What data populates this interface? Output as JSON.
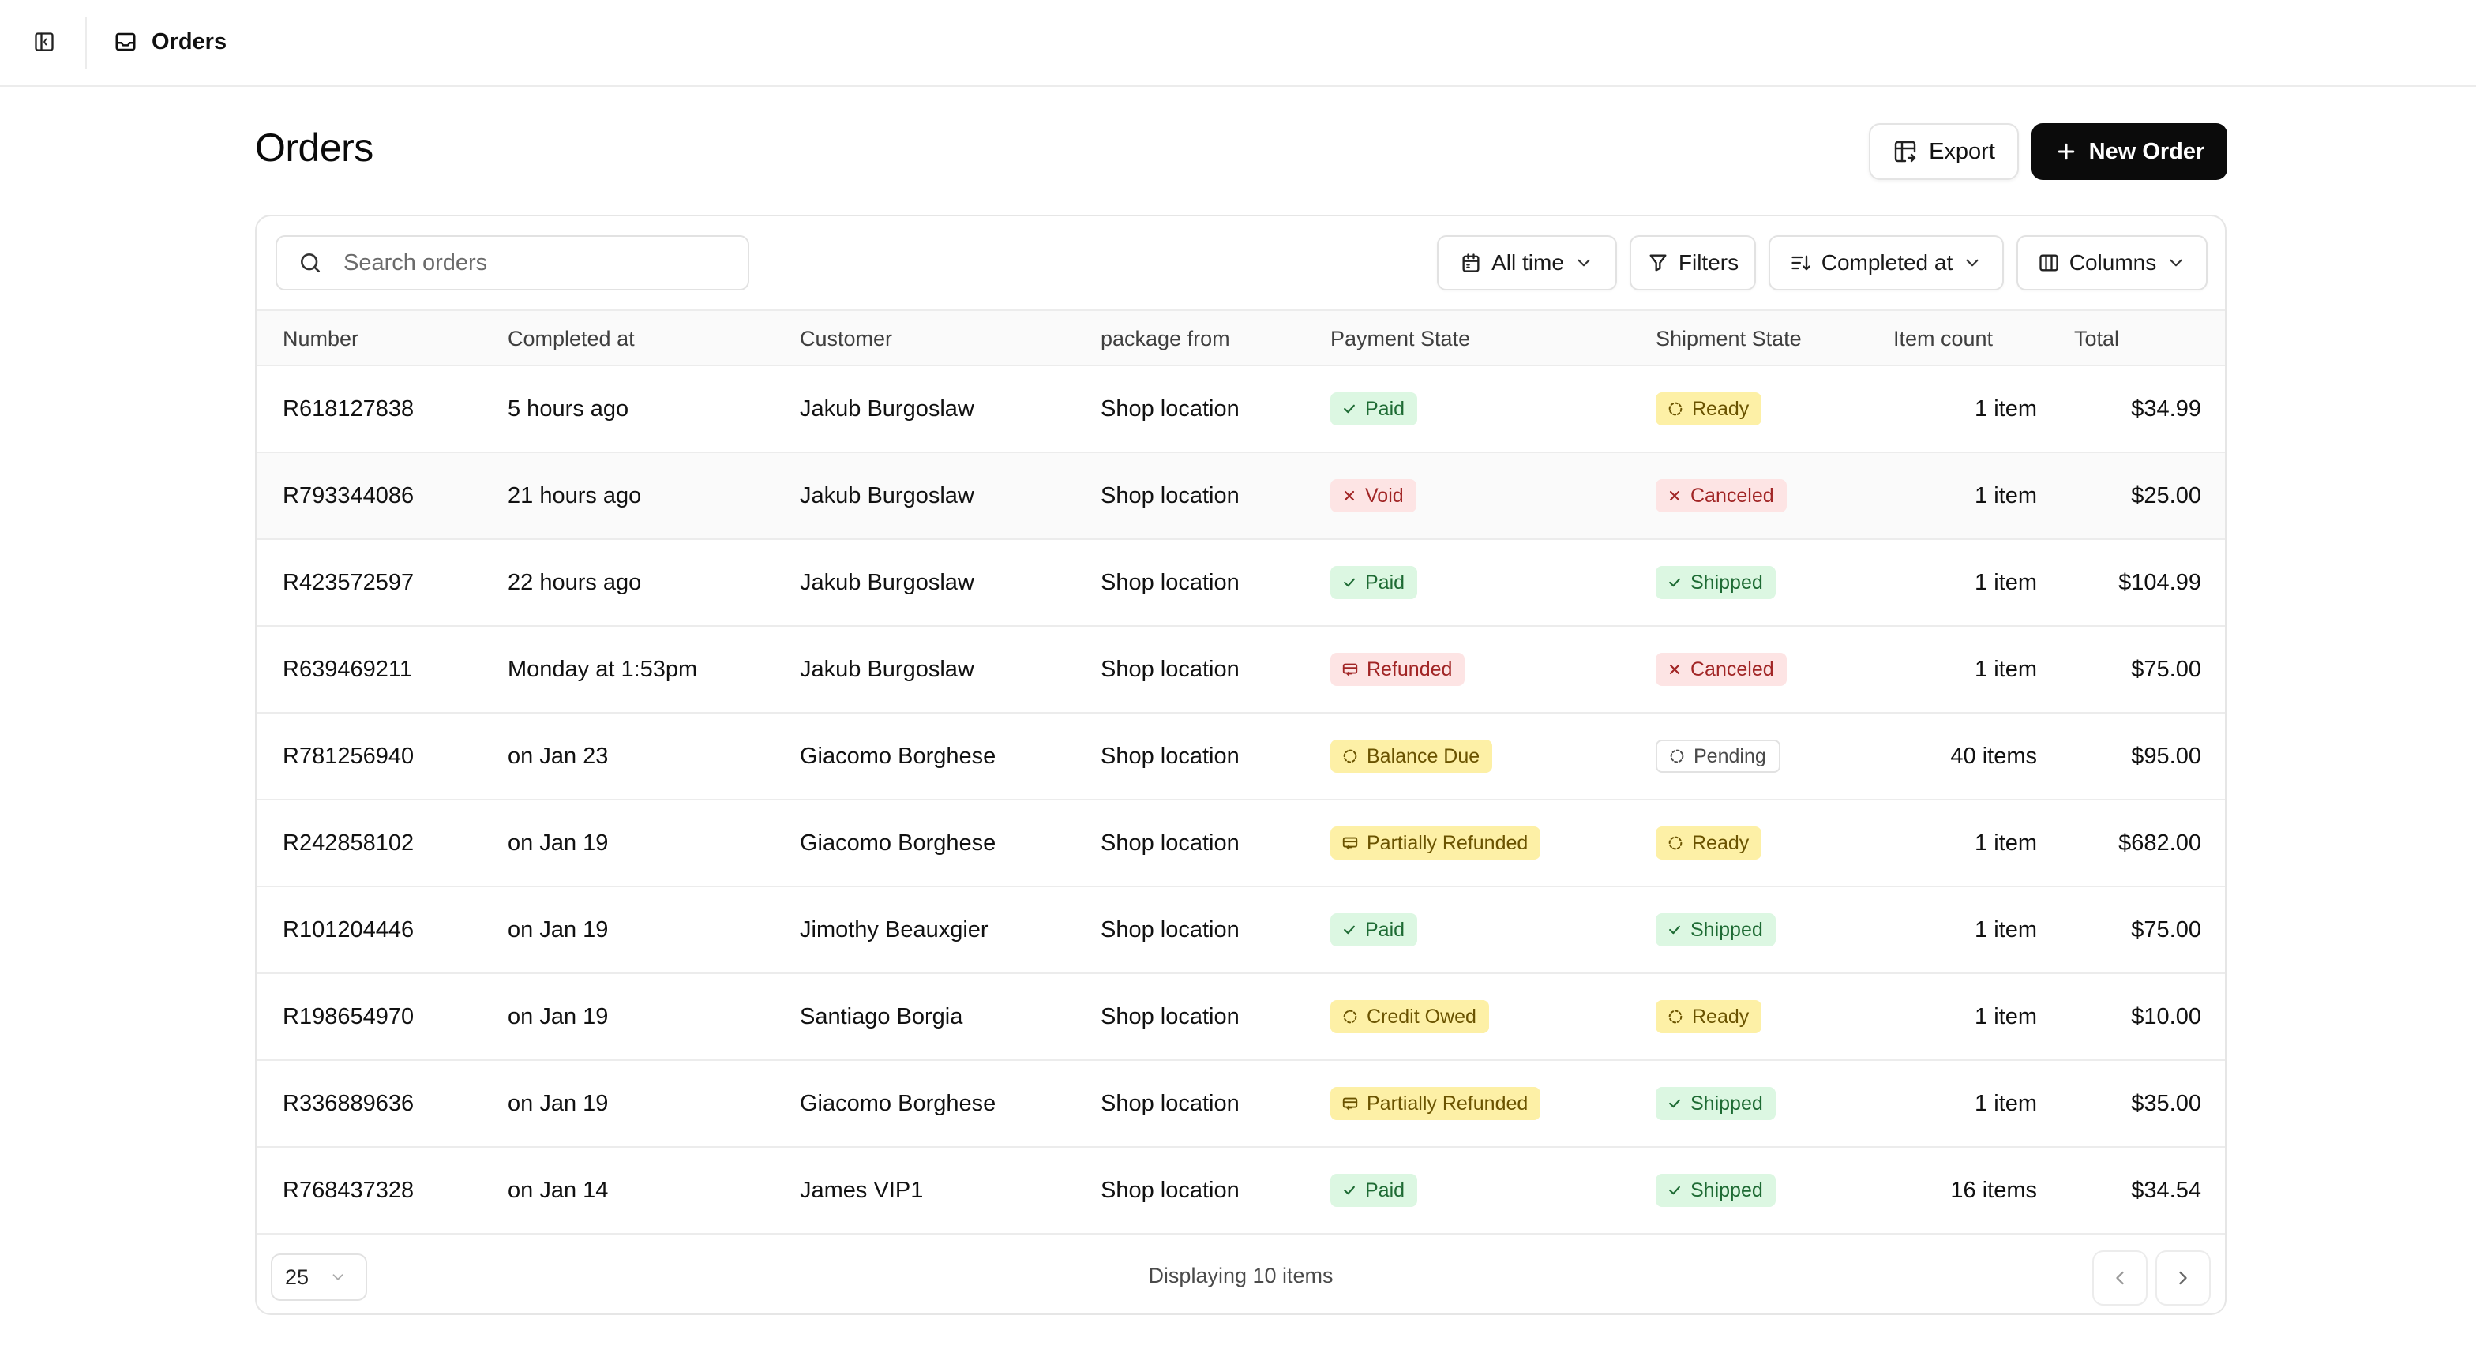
{
  "topbar": {
    "title": "Orders"
  },
  "header": {
    "title": "Orders",
    "export_label": "Export",
    "new_order_label": "New Order"
  },
  "toolbar": {
    "search_placeholder": "Search orders",
    "time_range": "All time",
    "filters_label": "Filters",
    "sort_label": "Completed at",
    "columns_label": "Columns"
  },
  "table": {
    "columns": [
      "Number",
      "Completed at",
      "Customer",
      "package from",
      "Payment State",
      "Shipment State",
      "Item count",
      "Total"
    ],
    "rows": [
      {
        "number": "R618127838",
        "completed_at": "5 hours ago",
        "customer": "Jakub Burgoslaw",
        "package_from": "Shop location",
        "payment": "Paid",
        "payment_tone": "green",
        "payment_icon": "check",
        "shipment": "Ready",
        "shipment_tone": "yellow",
        "shipment_icon": "dashed-circle",
        "items": "1 item",
        "total": "$34.99"
      },
      {
        "number": "R793344086",
        "completed_at": "21 hours ago",
        "customer": "Jakub Burgoslaw",
        "package_from": "Shop location",
        "payment": "Void",
        "payment_tone": "red",
        "payment_icon": "x",
        "shipment": "Canceled",
        "shipment_tone": "red",
        "shipment_icon": "x",
        "items": "1 item",
        "total": "$25.00"
      },
      {
        "number": "R423572597",
        "completed_at": "22 hours ago",
        "customer": "Jakub Burgoslaw",
        "package_from": "Shop location",
        "payment": "Paid",
        "payment_tone": "green",
        "payment_icon": "check",
        "shipment": "Shipped",
        "shipment_tone": "green",
        "shipment_icon": "check",
        "items": "1 item",
        "total": "$104.99"
      },
      {
        "number": "R639469211",
        "completed_at": "Monday at 1:53pm",
        "customer": "Jakub Burgoslaw",
        "package_from": "Shop location",
        "payment": "Refunded",
        "payment_tone": "red",
        "payment_icon": "receipt",
        "shipment": "Canceled",
        "shipment_tone": "red",
        "shipment_icon": "x",
        "items": "1 item",
        "total": "$75.00"
      },
      {
        "number": "R781256940",
        "completed_at": "on Jan 23",
        "customer": "Giacomo Borghese",
        "package_from": "Shop location",
        "payment": "Balance Due",
        "payment_tone": "yellow",
        "payment_icon": "dashed-circle",
        "shipment": "Pending",
        "shipment_tone": "gray",
        "shipment_icon": "dashed-circle",
        "items": "40 items",
        "total": "$95.00"
      },
      {
        "number": "R242858102",
        "completed_at": "on Jan 19",
        "customer": "Giacomo Borghese",
        "package_from": "Shop location",
        "payment": "Partially Refunded",
        "payment_tone": "yellow",
        "payment_icon": "receipt",
        "shipment": "Ready",
        "shipment_tone": "yellow",
        "shipment_icon": "dashed-circle",
        "items": "1 item",
        "total": "$682.00"
      },
      {
        "number": "R101204446",
        "completed_at": "on Jan 19",
        "customer": "Jimothy Beauxgier",
        "package_from": "Shop location",
        "payment": "Paid",
        "payment_tone": "green",
        "payment_icon": "check",
        "shipment": "Shipped",
        "shipment_tone": "green",
        "shipment_icon": "check",
        "items": "1 item",
        "total": "$75.00"
      },
      {
        "number": "R198654970",
        "completed_at": "on Jan 19",
        "customer": "Santiago Borgia",
        "package_from": "Shop location",
        "payment": "Credit Owed",
        "payment_tone": "yellow",
        "payment_icon": "dashed-circle",
        "shipment": "Ready",
        "shipment_tone": "yellow",
        "shipment_icon": "dashed-circle",
        "items": "1 item",
        "total": "$10.00"
      },
      {
        "number": "R336889636",
        "completed_at": "on Jan 19",
        "customer": "Giacomo Borghese",
        "package_from": "Shop location",
        "payment": "Partially Refunded",
        "payment_tone": "yellow",
        "payment_icon": "receipt",
        "shipment": "Shipped",
        "shipment_tone": "green",
        "shipment_icon": "check",
        "items": "1 item",
        "total": "$35.00"
      },
      {
        "number": "R768437328",
        "completed_at": "on Jan 14",
        "customer": "James VIP1",
        "package_from": "Shop location",
        "payment": "Paid",
        "payment_tone": "green",
        "payment_icon": "check",
        "shipment": "Shipped",
        "shipment_tone": "green",
        "shipment_icon": "check",
        "items": "16 items",
        "total": "$34.54"
      }
    ]
  },
  "footer": {
    "page_size": "25",
    "displaying": "Displaying 10 items"
  },
  "icons": {
    "sidebar_toggle": "sidebar-icon",
    "orders": "inbox-icon",
    "export": "table-export-icon",
    "new_order": "plus-icon",
    "search": "search-icon",
    "time": "calendar-icon",
    "filters": "funnel-icon",
    "sort": "sort-icon",
    "columns": "columns-icon",
    "dropdown": "chevron-down-icon",
    "prev": "chevron-left-icon",
    "next": "chevron-right-icon"
  },
  "colors": {
    "accent": "#0b0b0b",
    "green_bg": "#dcf7e2",
    "green_fg": "#1e6b34",
    "red_bg": "#fde4e4",
    "red_fg": "#a12525",
    "yellow_bg": "#fdf0a6",
    "yellow_fg": "#6a5300"
  }
}
